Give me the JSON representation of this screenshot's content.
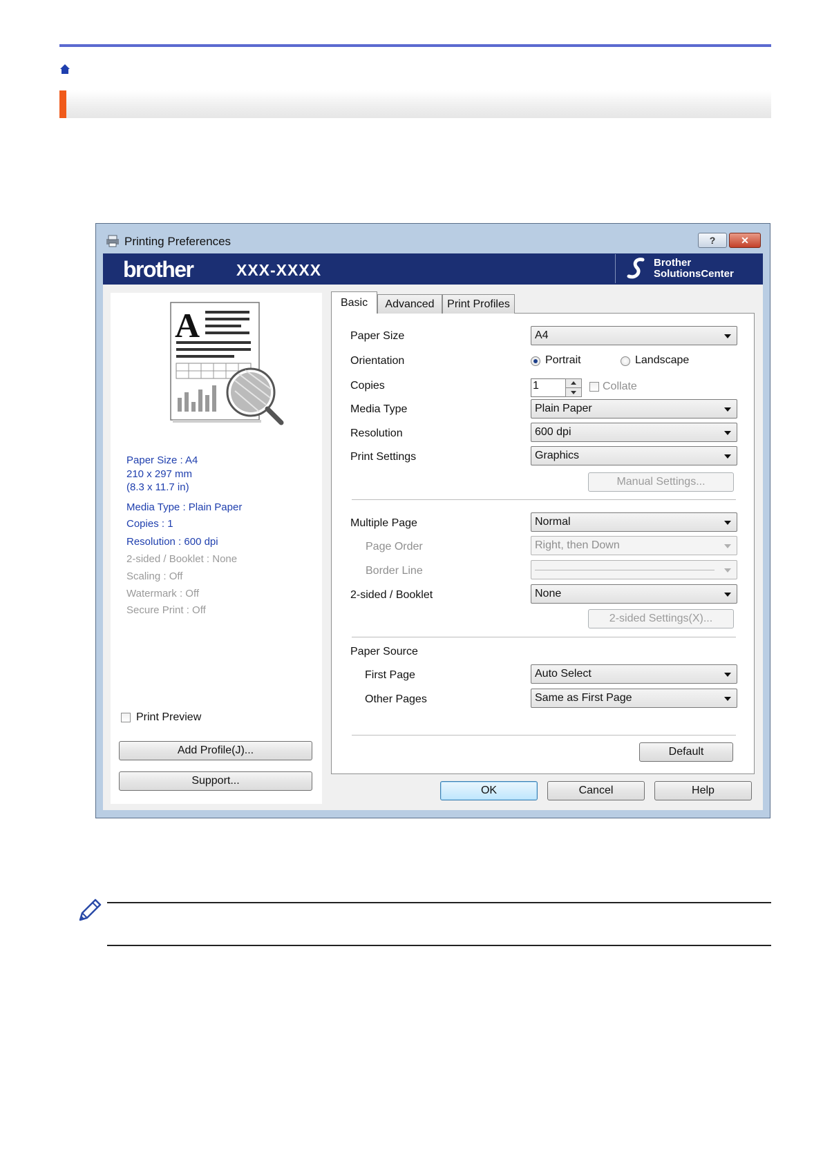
{
  "dialog": {
    "title": "Printing Preferences",
    "help_label": "?",
    "close_label": "✕",
    "brand": "brother",
    "model": "XXX-XXXX",
    "solutions_center": [
      "Brother",
      "SolutionsCenter"
    ]
  },
  "left_panel": {
    "info_active": [
      "Paper Size : A4",
      "210 x 297 mm",
      "(8.3 x 11.7 in)",
      "Media Type : Plain Paper",
      "Copies : 1",
      "Resolution : 600 dpi"
    ],
    "info_dim": [
      "2-sided / Booklet : None",
      "Scaling : Off",
      "Watermark : Off",
      "Secure Print : Off"
    ],
    "print_preview_label": "Print Preview",
    "add_profile_label": "Add Profile(J)...",
    "support_label": "Support..."
  },
  "tabs": [
    "Basic",
    "Advanced",
    "Print Profiles"
  ],
  "basic": {
    "paper_size_label": "Paper Size",
    "paper_size_value": "A4",
    "orientation_label": "Orientation",
    "portrait_label": "Portrait",
    "landscape_label": "Landscape",
    "copies_label": "Copies",
    "copies_value": "1",
    "collate_label": "Collate",
    "media_type_label": "Media Type",
    "media_type_value": "Plain Paper",
    "resolution_label": "Resolution",
    "resolution_value": "600 dpi",
    "print_settings_label": "Print Settings",
    "print_settings_value": "Graphics",
    "manual_settings_label": "Manual Settings...",
    "multiple_page_label": "Multiple Page",
    "multiple_page_value": "Normal",
    "page_order_label": "Page Order",
    "page_order_value": "Right, then Down",
    "border_line_label": "Border Line",
    "two_sided_label": "2-sided / Booklet",
    "two_sided_value": "None",
    "two_sided_settings_label": "2-sided Settings(X)...",
    "paper_source_label": "Paper Source",
    "first_page_label": "First Page",
    "first_page_value": "Auto Select",
    "other_pages_label": "Other Pages",
    "other_pages_value": "Same as First Page",
    "default_label": "Default"
  },
  "footer": {
    "ok_label": "OK",
    "cancel_label": "Cancel",
    "help_label": "Help"
  }
}
